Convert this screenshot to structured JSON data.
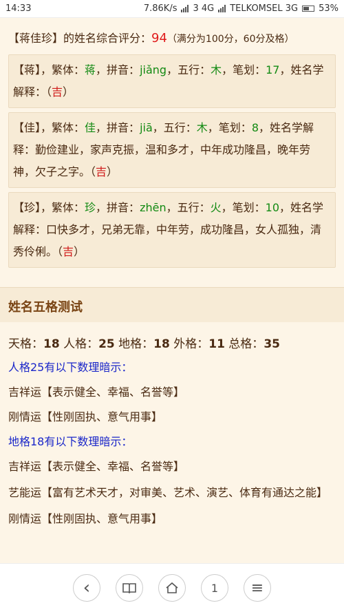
{
  "status_bar": {
    "time": "14:33",
    "speed": "7.86K/s",
    "sim1": "3 4G",
    "carrier": "TELKOMSEL 3G",
    "battery": "53%"
  },
  "summary": {
    "name": "【蒋佳珍】",
    "text": "的姓名综合评分：",
    "score": "94",
    "note": "（满分为100分，60分及格）"
  },
  "chars": [
    {
      "head": "【蒋】",
      "mid1": "，繁体：",
      "trad": "蒋",
      "mid2": "，拼音：",
      "pinyin": "jiǎng",
      "mid3": "，五行：",
      "element": "木",
      "mid4": "，笔划：",
      "strokes": "17",
      "mid5": "，姓名学解释：",
      "meaning": "",
      "open": "（",
      "luck": "吉",
      "close": "）"
    },
    {
      "head": "【佳】",
      "mid1": "，繁体：",
      "trad": "佳",
      "mid2": "，拼音：",
      "pinyin": "jiā",
      "mid3": "，五行：",
      "element": "木",
      "mid4": "，笔划：",
      "strokes": "8",
      "mid5": "，姓名学解释：",
      "meaning": "勤俭建业，家声克振，温和多才，中年成功隆昌，晚年劳神，欠子之字。",
      "open": "（",
      "luck": "吉",
      "close": "）"
    },
    {
      "head": "【珍】",
      "mid1": "，繁体：",
      "trad": "珍",
      "mid2": "，拼音：",
      "pinyin": "zhēn",
      "mid3": "，五行：",
      "element": "火",
      "mid4": "，笔划：",
      "strokes": "10",
      "mid5": "，姓名学解释：",
      "meaning": "口快多才，兄弟无靠，中年劳，成功隆昌，女人孤独，清秀伶俐。",
      "open": "（",
      "luck": "吉",
      "close": "）"
    }
  ],
  "section_title": "姓名五格测试",
  "wuge": {
    "tian_label": "天格：",
    "tian": "18",
    "ren_label": " 人格：",
    "ren": "25",
    "di_label": " 地格：",
    "di": "18",
    "wai_label": " 外格：",
    "wai": "11",
    "zong_label": " 总格：",
    "zong": "35"
  },
  "lines": [
    {
      "text": "人格25有以下数理暗示：",
      "blue": true
    },
    {
      "text": "吉祥运【表示健全、幸福、名誉等】",
      "blue": false
    },
    {
      "text": "刚情运【性刚固执、意气用事】",
      "blue": false
    },
    {
      "text": "地格18有以下数理暗示：",
      "blue": true
    },
    {
      "text": "吉祥运【表示健全、幸福、名誉等】",
      "blue": false
    },
    {
      "text": "艺能运【富有艺术天才，对审美、艺术、演艺、体育有通达之能】",
      "blue": false
    },
    {
      "text": "刚情运【性刚固执、意气用事】",
      "blue": false
    }
  ],
  "nav": {
    "back": "‹",
    "book": "📖",
    "home": "⌂",
    "tabs": "1",
    "menu": "≡"
  }
}
